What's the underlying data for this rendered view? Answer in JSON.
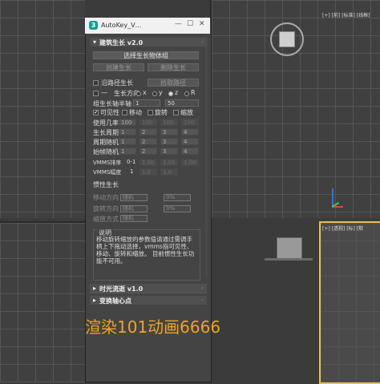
{
  "viewports": {
    "top_right_label": "[+] [前] [标准] [线框]",
    "bottom_right_label": "[+] [透视] [标] [默"
  },
  "window": {
    "title": "AutoKey_V…",
    "logo": "3",
    "minimize": "—",
    "maximize": "☐",
    "close": "✕"
  },
  "rollouts": {
    "growth": {
      "arrow": "▾",
      "title": "建筑生长 v2.0",
      "select_group_button": "选择生长物体组",
      "create_growth_button": "创建生长",
      "delete_growth_button": "删除生长",
      "path_growth_checkbox": "沿路径生长",
      "pick_path_button": "拾取路径",
      "dash_label": "—",
      "growth_dir_label": "生长方向",
      "axes": [
        "x",
        "y",
        "z",
        "R"
      ],
      "axis_selected": "z",
      "axis_label": "组生长轴半轴",
      "axis_value": "1",
      "axis_value2": "50",
      "visibility": "可见性",
      "move": "移动",
      "rotate": "旋转",
      "scale": "缩放",
      "prob_label": "使用几率",
      "prob_values": [
        "100",
        "100",
        "100",
        "100"
      ],
      "cycle_label": "生长周期",
      "cycle_values": [
        "1",
        "2",
        "3",
        "4"
      ],
      "period_random_label": "周期随机",
      "period_random_values": [
        "1",
        "2",
        "3",
        "4"
      ],
      "start_random_label": "始帧随机",
      "start_random_values": [
        "1",
        "2",
        "3",
        "4"
      ],
      "vmms_order_label": "VMMS排序",
      "vmms_order_value": "0-1",
      "vmms_order_values": [
        "1.00",
        "1.00",
        "1.00"
      ],
      "vmms_amp_label": "VMMS幅度",
      "vmms_amp_value": "1",
      "vmms_amp_values": [
        "1.0",
        "1.0"
      ],
      "inertia_label": "惯性生长",
      "move_dir_label": "移动方向",
      "rotate_dir_label": "旋转方向",
      "scale_mode_label": "缩放方式",
      "field_placeholder": "随机",
      "field_placeholder2": "0%",
      "notes_title": "说明",
      "notes_text": "移动旋转缩放的参数值请通过需调手柄上下拖动选择，vmms指可见性、移动、旋转和缩放。 目前惯性生长功能不可用。"
    },
    "time_flow": {
      "arrow": "▸",
      "title": "时光流逝 v1.0"
    },
    "pivot": {
      "arrow": "▸",
      "title": "变换轴心点"
    }
  },
  "watermark": "渲染101动画6666"
}
